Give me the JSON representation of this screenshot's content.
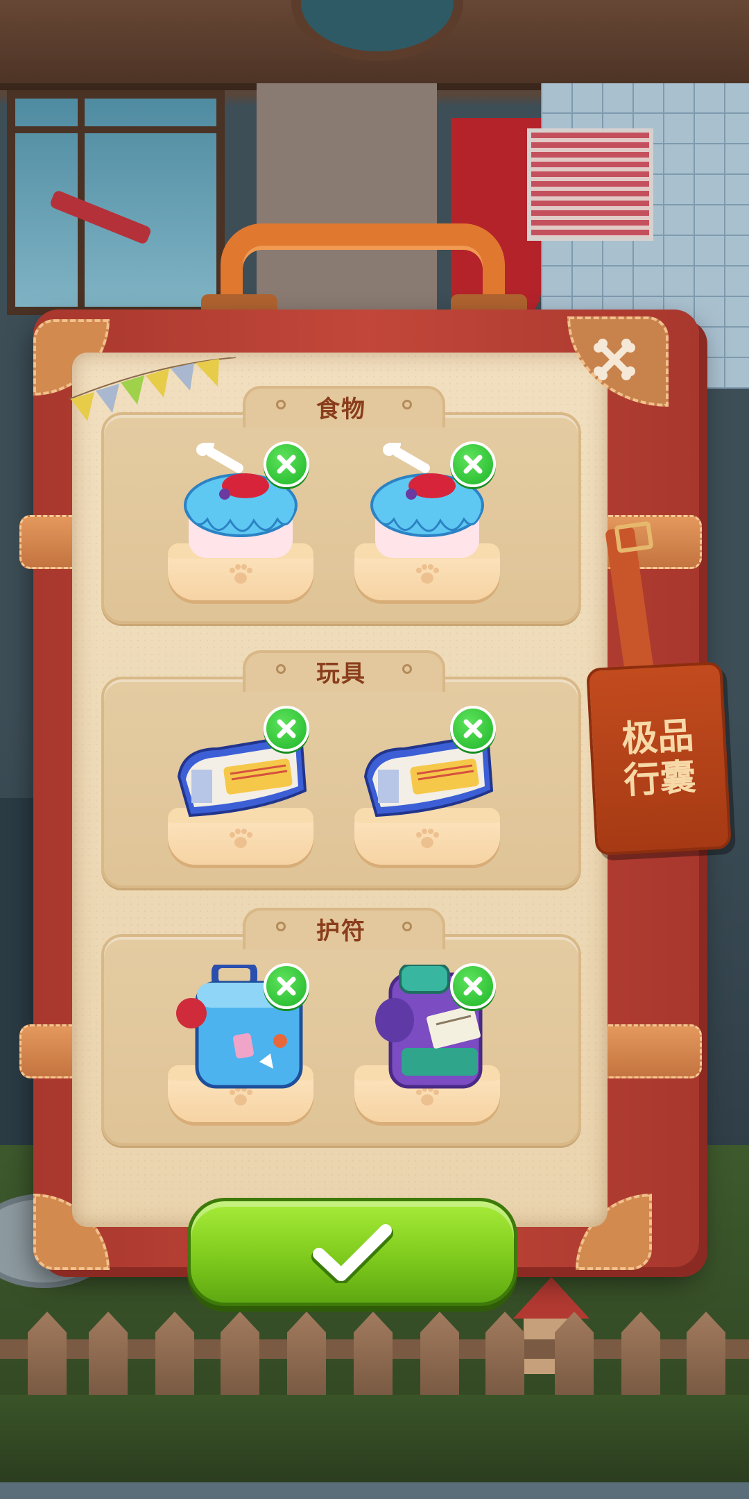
{
  "sections": [
    {
      "title": "食物",
      "items": [
        {
          "name": "blue-cake"
        },
        {
          "name": "blue-cake"
        }
      ]
    },
    {
      "title": "玩具",
      "items": [
        {
          "name": "blue-ticket-toy"
        },
        {
          "name": "blue-ticket-toy"
        }
      ]
    },
    {
      "title": "护符",
      "items": [
        {
          "name": "blue-suitcase-charm"
        },
        {
          "name": "purple-suitcase-charm"
        }
      ]
    }
  ],
  "tag": {
    "line1": "极品",
    "line2": "行囊"
  },
  "icons": {
    "close": "crossed-bones-icon",
    "remove": "close-icon",
    "confirm": "checkmark-icon"
  },
  "colors": {
    "suitcase": "#c2473a",
    "panel": "#f1dfbf",
    "confirm_green": "#7fcb1d",
    "remove_green": "#2ec63a",
    "tag": "#b8431a"
  }
}
